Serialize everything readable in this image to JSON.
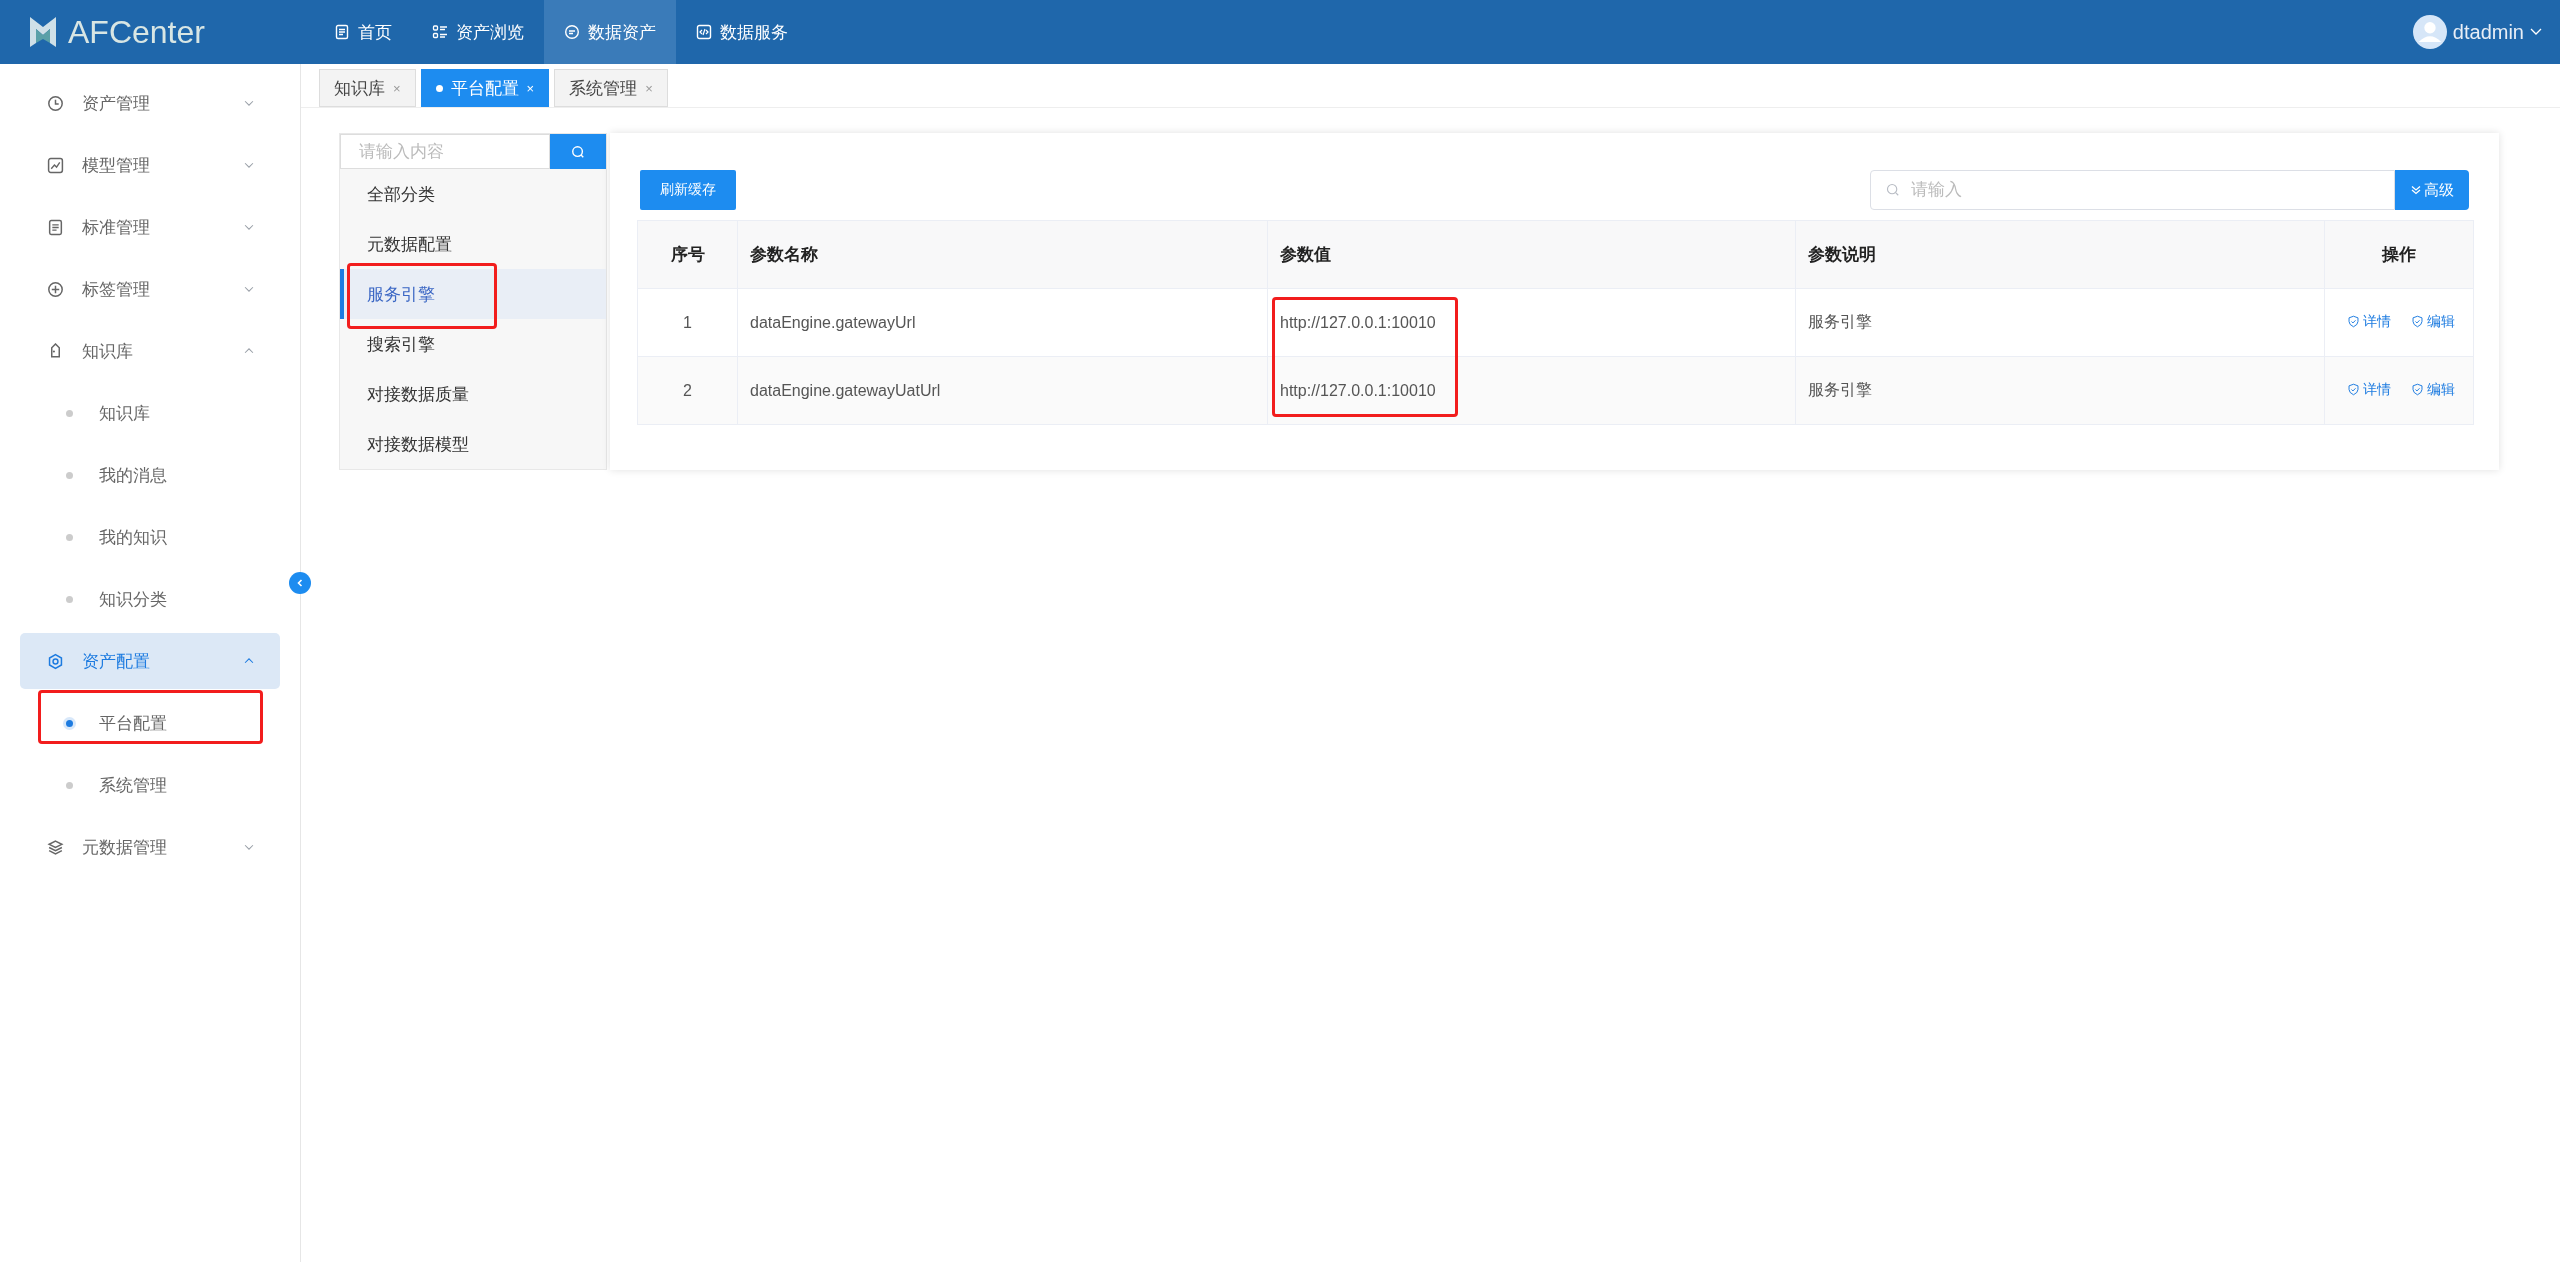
{
  "header": {
    "logo": "AFCenter",
    "nav": [
      {
        "label": "首页",
        "selected": false
      },
      {
        "label": "资产浏览",
        "selected": false
      },
      {
        "label": "数据资产",
        "selected": true
      },
      {
        "label": "数据服务",
        "selected": false
      }
    ],
    "user": "dtadmin"
  },
  "sidebar": {
    "items": [
      {
        "label": "资产管理",
        "expanded": false,
        "selected": false
      },
      {
        "label": "模型管理",
        "expanded": false,
        "selected": false
      },
      {
        "label": "标准管理",
        "expanded": false,
        "selected": false
      },
      {
        "label": "标签管理",
        "expanded": false,
        "selected": false
      },
      {
        "label": "知识库",
        "expanded": true,
        "selected": false,
        "children": [
          {
            "label": "知识库",
            "selected": false,
            "annotated": false
          },
          {
            "label": "我的消息",
            "selected": false,
            "annotated": false
          },
          {
            "label": "我的知识",
            "selected": false,
            "annotated": false
          },
          {
            "label": "知识分类",
            "selected": false,
            "annotated": false
          }
        ]
      },
      {
        "label": "资产配置",
        "expanded": true,
        "selected": true,
        "children": [
          {
            "label": "平台配置",
            "selected": true,
            "annotated": true
          },
          {
            "label": "系统管理",
            "selected": false,
            "annotated": false
          }
        ]
      },
      {
        "label": "元数据管理",
        "expanded": false,
        "selected": false
      }
    ]
  },
  "tabs": [
    {
      "label": "知识库",
      "close": "×",
      "selected": false
    },
    {
      "label": "平台配置",
      "close": "×",
      "selected": true
    },
    {
      "label": "系统管理",
      "close": "×",
      "selected": false
    }
  ],
  "categories": {
    "search": {
      "placeholder": "请输入内容"
    },
    "items": [
      {
        "label": "全部分类",
        "selected": false,
        "annotated": false
      },
      {
        "label": "元数据配置",
        "selected": false,
        "annotated": false
      },
      {
        "label": "服务引擎",
        "selected": true,
        "annotated": true
      },
      {
        "label": "搜索引擎",
        "selected": false,
        "annotated": false
      },
      {
        "label": "对接数据质量",
        "selected": false,
        "annotated": false
      },
      {
        "label": "对接数据模型",
        "selected": false,
        "annotated": false
      }
    ]
  },
  "toolbar": {
    "refresh_button": "刷新缓存",
    "search": {
      "placeholder": "请输入"
    },
    "advanced_button": "高级"
  },
  "table": {
    "columns": [
      {
        "label": "序号",
        "annotated": false
      },
      {
        "label": "参数名称",
        "annotated": false
      },
      {
        "label": "参数值",
        "annotated": true
      },
      {
        "label": "参数说明",
        "annotated": false
      },
      {
        "label": "操作",
        "annotated": false
      }
    ],
    "rows": [
      {
        "cells": [
          "1",
          "dataEngine.gatewayUrl",
          "http://127.0.0.1:10010",
          "服务引擎"
        ],
        "actions": [
          "详情",
          "编辑"
        ]
      },
      {
        "cells": [
          "2",
          "dataEngine.gatewayUatUrl",
          "http://127.0.0.1:10010",
          "服务引擎"
        ],
        "actions": [
          "详情",
          "编辑"
        ]
      }
    ]
  }
}
